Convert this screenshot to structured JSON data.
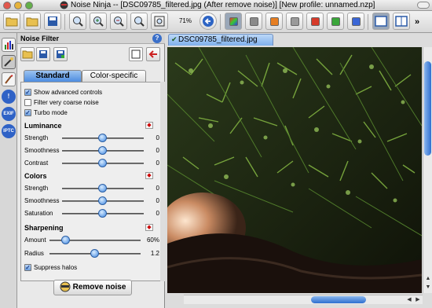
{
  "window": {
    "title": "Noise Ninja -- [DSC09785_filtered.jpg (After remove noise)] [New profile: unnamed.nzp]"
  },
  "toolbar": {
    "zoom": "71%",
    "overflow": "»"
  },
  "sidebar": {
    "items": [
      {
        "icon": "histogram-icon",
        "label": ""
      },
      {
        "icon": "noise-filter-icon",
        "label": ""
      },
      {
        "icon": "brush-icon",
        "label": ""
      },
      {
        "icon": "warning-icon",
        "label": "!"
      },
      {
        "icon": "exif-icon",
        "label": "EXIF"
      },
      {
        "icon": "iptc-icon",
        "label": "IPTC"
      }
    ]
  },
  "panel": {
    "title": "Noise Filter",
    "help": "?",
    "tabs": [
      "Standard",
      "Color-specific"
    ],
    "options": [
      {
        "label": "Show advanced controls",
        "checked": true
      },
      {
        "label": "Filter very coarse noise",
        "checked": false
      },
      {
        "label": "Turbo mode",
        "checked": true
      }
    ],
    "luminance": {
      "title": "Luminance",
      "sliders": [
        {
          "label": "Strength",
          "value": "0",
          "position": 0.5
        },
        {
          "label": "Smoothness",
          "value": "0",
          "position": 0.5
        },
        {
          "label": "Contrast",
          "value": "0",
          "position": 0.5
        }
      ]
    },
    "colors": {
      "title": "Colors",
      "sliders": [
        {
          "label": "Strength",
          "value": "0",
          "position": 0.5
        },
        {
          "label": "Smoothness",
          "value": "0",
          "position": 0.5
        },
        {
          "label": "Saturation",
          "value": "0",
          "position": 0.5
        }
      ]
    },
    "sharpening": {
      "title": "Sharpening",
      "sliders": [
        {
          "label": "Amount",
          "value": "60%",
          "position": 0.18
        },
        {
          "label": "Radius",
          "value": "1.2",
          "position": 0.5
        }
      ],
      "suppress_halos": {
        "label": "Suppress halos",
        "checked": true
      }
    },
    "remove_button": "Remove noise"
  },
  "document": {
    "tab_label": "DSC09785_filtered.jpg",
    "close": "✔"
  }
}
